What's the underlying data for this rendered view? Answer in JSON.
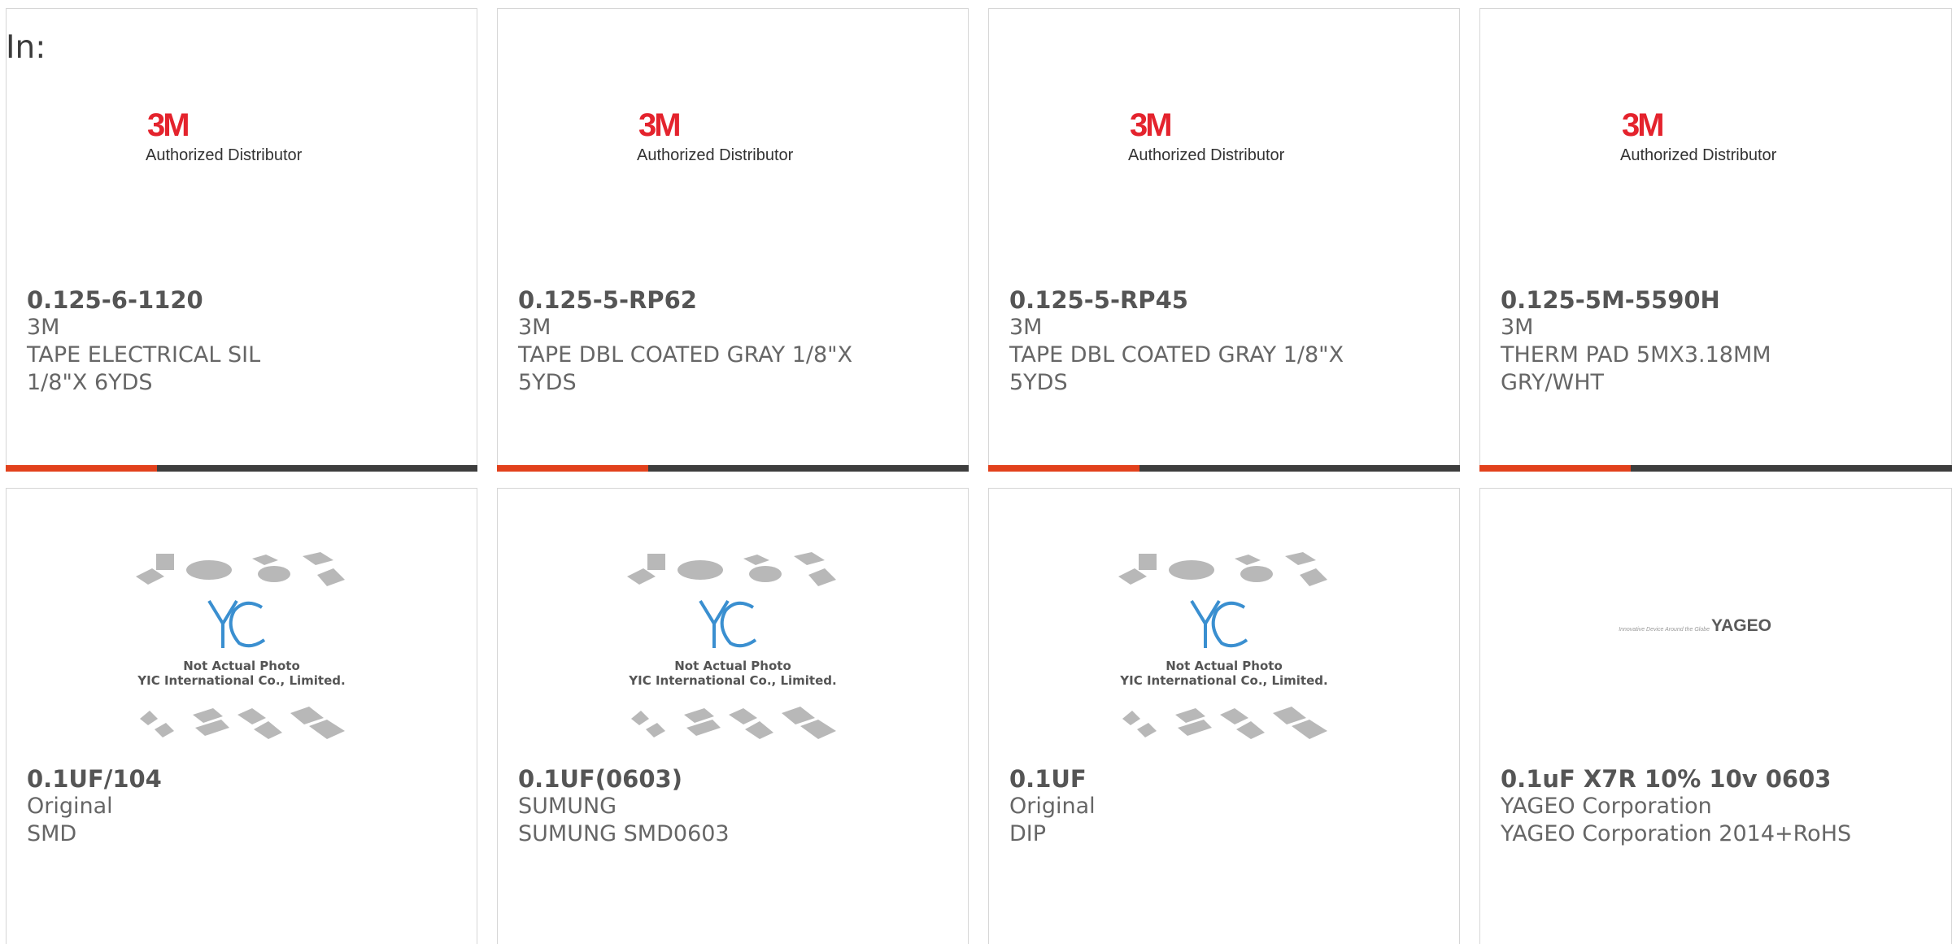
{
  "header": {
    "prefix": "In:"
  },
  "products": [
    {
      "part": "0.125-6-1120",
      "brand": "3M",
      "desc": "TAPE ELECTRICAL SIL 1/8\"X 6YDS",
      "image": "3m-authorized-distributor-logo",
      "logo_text": "Authorized Distributor"
    },
    {
      "part": "0.125-5-RP62",
      "brand": "3M",
      "desc": "TAPE DBL COATED GRAY 1/8\"X 5YDS",
      "image": "3m-authorized-distributor-logo",
      "logo_text": "Authorized Distributor"
    },
    {
      "part": "0.125-5-RP45",
      "brand": "3M",
      "desc": "TAPE DBL COATED GRAY 1/8\"X 5YDS",
      "image": "3m-authorized-distributor-logo",
      "logo_text": "Authorized Distributor"
    },
    {
      "part": "0.125-5M-5590H",
      "brand": "3M",
      "desc": "THERM PAD 5MX3.18MM GRY/WHT",
      "image": "3m-authorized-distributor-logo",
      "logo_text": "Authorized Distributor"
    },
    {
      "part": "0.1UF/104",
      "brand": "Original",
      "desc": "SMD",
      "image": "yic-not-actual-photo",
      "photo_line1": "Not Actual Photo",
      "photo_line2": "YIC International Co., Limited."
    },
    {
      "part": "0.1UF(0603)",
      "brand": "SUMUNG",
      "desc": "SUMUNG SMD0603",
      "image": "yic-not-actual-photo",
      "photo_line1": "Not Actual Photo",
      "photo_line2": "YIC International Co., Limited."
    },
    {
      "part": "0.1UF",
      "brand": "Original",
      "desc": "DIP",
      "image": "yic-not-actual-photo",
      "photo_line1": "Not Actual Photo",
      "photo_line2": "YIC International Co., Limited."
    },
    {
      "part": "0.1uF X7R 10% 10v 0603",
      "brand": "YAGEO Corporation",
      "desc": "YAGEO Corporation 2014+RoHS",
      "image": "yageo-logo",
      "logo_text": "YAGEO",
      "tagline": "Innovative Device Around the Globe"
    }
  ],
  "colors": {
    "accent": "#e2411c",
    "bar": "#3d3d3d",
    "logo_red": "#e4232d",
    "yic_blue": "#3a8fd0"
  }
}
